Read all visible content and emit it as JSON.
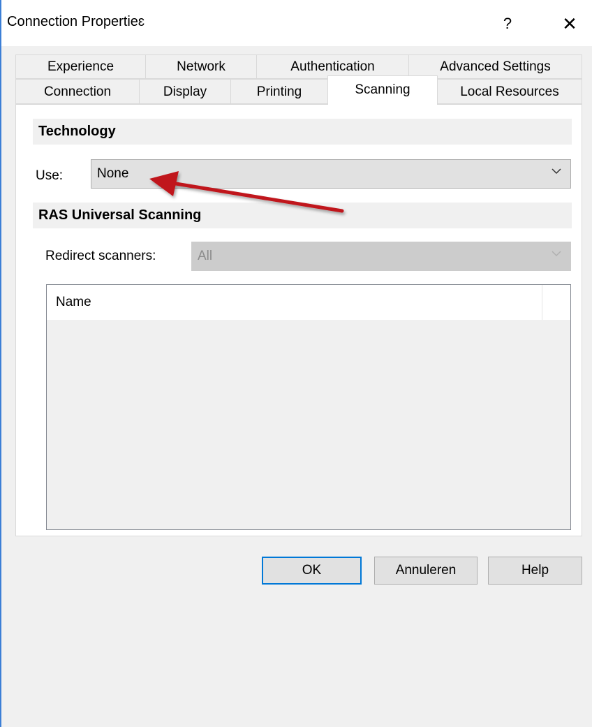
{
  "window": {
    "title": "Connection Propertieɛ",
    "help_glyph": "?",
    "close_glyph": "✕"
  },
  "tabs": {
    "row1": [
      "Experience",
      "Network",
      "Authentication",
      "Advanced Settings"
    ],
    "row2": [
      "Connection",
      "Display",
      "Printing",
      "Scanning",
      "Local Resources"
    ],
    "active": "Scanning"
  },
  "technology": {
    "header": "Technology",
    "use_label": "Use:",
    "use_value": "None"
  },
  "ras": {
    "header": "RAS Universal Scanning",
    "redirect_label": "Redirect scanners:",
    "redirect_value": "All"
  },
  "list": {
    "columns": [
      "Name"
    ]
  },
  "buttons": {
    "ok": "OK",
    "cancel": "Annuleren",
    "help": "Help"
  },
  "colors": {
    "accent": "#0078d7",
    "annotation_arrow": "#c0141a"
  },
  "icons": {
    "dropdown": "chevron-down-icon",
    "close": "close-icon"
  }
}
